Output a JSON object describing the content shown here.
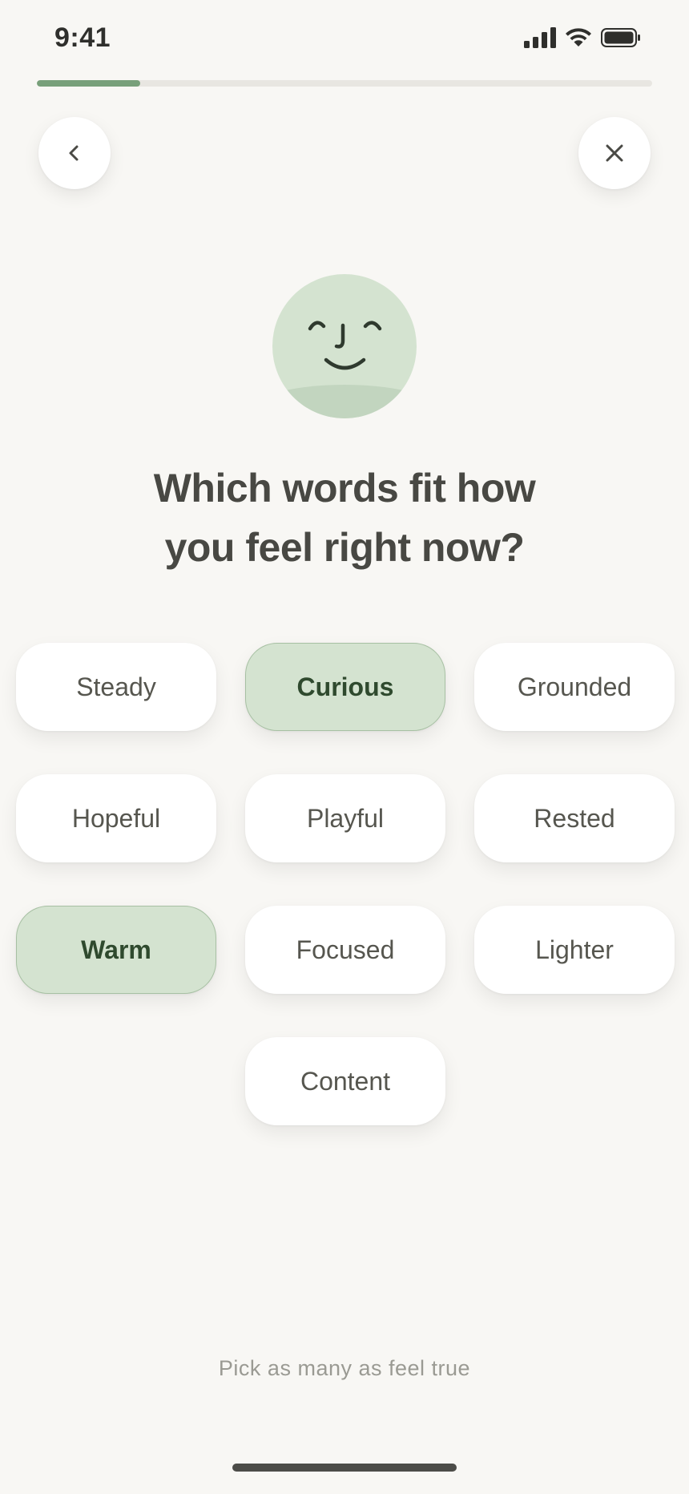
{
  "status_bar": {
    "time": "9:41",
    "icons": [
      "cellular-signal-icon",
      "wifi-icon",
      "battery-icon"
    ]
  },
  "progress": {
    "fraction": 0.168,
    "track_color": "#e8e6e1",
    "fill_color": "#78a07a"
  },
  "nav": {
    "back_icon": "chevron-left-icon",
    "close_icon": "close-icon"
  },
  "mascot": {
    "icon": "smiling-face-icon",
    "color": "#d4e3d0"
  },
  "question": {
    "line1": "Which words fit how",
    "line2": "you feel right now?"
  },
  "chips": [
    {
      "label": "Steady",
      "selected": false
    },
    {
      "label": "Curious",
      "selected": true
    },
    {
      "label": "Grounded",
      "selected": false
    },
    {
      "label": "Hopeful",
      "selected": false
    },
    {
      "label": "Playful",
      "selected": false
    },
    {
      "label": "Rested",
      "selected": false
    },
    {
      "label": "Warm",
      "selected": true
    },
    {
      "label": "Focused",
      "selected": false
    },
    {
      "label": "Lighter",
      "selected": false
    },
    {
      "label": "Content",
      "selected": false
    }
  ],
  "hint": "Pick as many as feel true",
  "colors": {
    "background": "#f8f7f4",
    "selected_chip": "#d4e3d0",
    "selected_text": "#2f4a2e",
    "chip": "#ffffff"
  }
}
